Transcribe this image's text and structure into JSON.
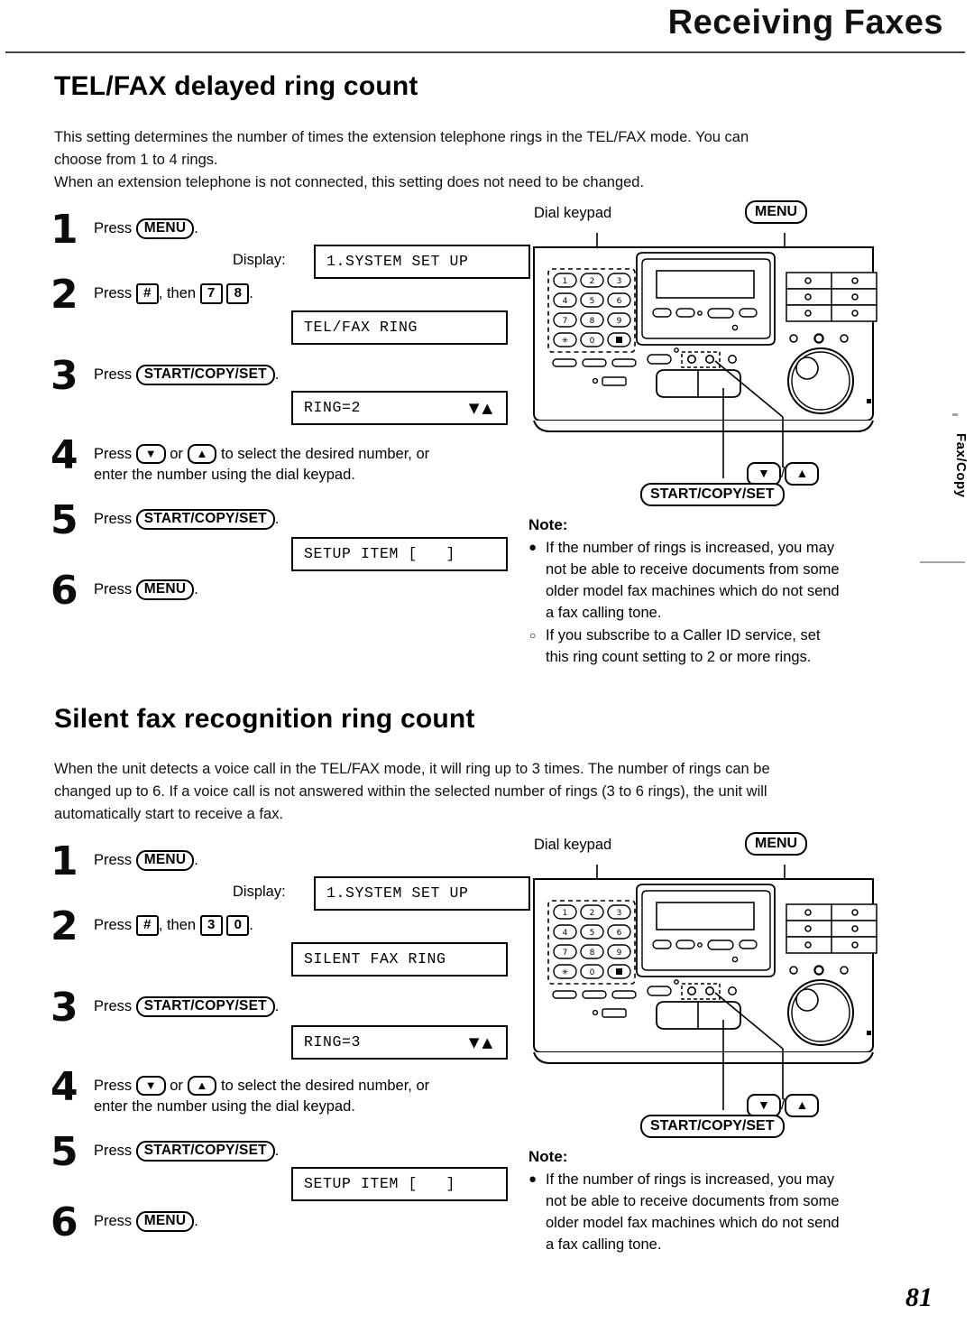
{
  "header": {
    "title": "Receiving Faxes"
  },
  "side_tab": {
    "label": "Fax/Copy"
  },
  "page_number": "81",
  "sections": [
    {
      "title": "TEL/FAX delayed ring count",
      "intro": [
        "This setting determines the number of times the extension telephone rings in the TEL/FAX mode. You can",
        "choose from 1 to 4 rings.",
        "When an extension telephone is not connected, this setting does not need to be changed."
      ],
      "steps": [
        {
          "num": "1",
          "press": "Press",
          "key": "MENU",
          "period": "."
        },
        {
          "num": "2",
          "press": "Press",
          "key1": "#",
          "mid": ", then",
          "key2": "7",
          "key3": "8",
          "period": "."
        },
        {
          "num": "3",
          "press": "Press",
          "key": "START/COPY/SET",
          "period": "."
        },
        {
          "num": "4",
          "press": "Press",
          "key1": "▼",
          "mid": "or",
          "key2": "▲",
          "line1_tail": "to select the desired number, or",
          "line2": "enter the number using the dial keypad."
        },
        {
          "num": "5",
          "press": "Press",
          "key": "START/COPY/SET",
          "period": "."
        },
        {
          "num": "6",
          "press": "Press",
          "key": "MENU",
          "period": "."
        }
      ],
      "display_label": "Display:",
      "lcds": [
        {
          "text": "1.SYSTEM SET UP",
          "arrows": ""
        },
        {
          "text": "TEL/FAX RING",
          "arrows": ""
        },
        {
          "text": "RING=2",
          "arrows": "▼▲"
        },
        {
          "text": "SETUP ITEM [   ]",
          "arrows": ""
        }
      ],
      "diagram": {
        "keypad_label": "Dial keypad",
        "menu_label": "MENU",
        "arrows_label_down": "▼",
        "arrows_label_sep": "/",
        "arrows_label_up": "▲",
        "start_label": "START/COPY/SET",
        "keys": [
          "1",
          "2",
          "3",
          "4",
          "5",
          "6",
          "7",
          "8",
          "9",
          "✳",
          "0",
          "■"
        ]
      },
      "note": {
        "title": "Note:",
        "items": [
          {
            "bullet": "filled",
            "lines": [
              "If the number of rings is increased, you may",
              "not be able to receive documents from some",
              "older model fax machines which do not send",
              "a fax calling tone."
            ]
          },
          {
            "bullet": "hollow",
            "lines": [
              "If you subscribe to a Caller ID service, set",
              "this ring count setting to 2 or more rings."
            ]
          }
        ]
      }
    },
    {
      "title": "Silent fax recognition ring count",
      "intro": [
        "When the unit detects a voice call in the TEL/FAX mode, it will ring up to 3 times. The number of rings can be",
        "changed up to 6. If a voice call is not answered within the selected number of rings (3 to 6 rings), the unit will",
        "automatically start to receive a fax."
      ],
      "steps": [
        {
          "num": "1",
          "press": "Press",
          "key": "MENU",
          "period": "."
        },
        {
          "num": "2",
          "press": "Press",
          "key1": "#",
          "mid": ", then",
          "key2": "3",
          "key3": "0",
          "period": "."
        },
        {
          "num": "3",
          "press": "Press",
          "key": "START/COPY/SET",
          "period": "."
        },
        {
          "num": "4",
          "press": "Press",
          "key1": "▼",
          "mid": "or",
          "key2": "▲",
          "line1_tail": "to select the desired number, or",
          "line2": "enter the number using the dial keypad."
        },
        {
          "num": "5",
          "press": "Press",
          "key": "START/COPY/SET",
          "period": "."
        },
        {
          "num": "6",
          "press": "Press",
          "key": "MENU",
          "period": "."
        }
      ],
      "display_label": "Display:",
      "lcds": [
        {
          "text": "1.SYSTEM SET UP",
          "arrows": ""
        },
        {
          "text": "SILENT FAX RING",
          "arrows": ""
        },
        {
          "text": "RING=3",
          "arrows": "▼▲"
        },
        {
          "text": "SETUP ITEM [   ]",
          "arrows": ""
        }
      ],
      "diagram": {
        "keypad_label": "Dial keypad",
        "menu_label": "MENU",
        "arrows_label_down": "▼",
        "arrows_label_sep": "/",
        "arrows_label_up": "▲",
        "start_label": "START/COPY/SET",
        "keys": [
          "1",
          "2",
          "3",
          "4",
          "5",
          "6",
          "7",
          "8",
          "9",
          "✳",
          "0",
          "■"
        ]
      },
      "note": {
        "title": "Note:",
        "items": [
          {
            "bullet": "filled",
            "lines": [
              "If the number of rings is increased, you may",
              "not be able to receive documents from some",
              "older model fax machines which do not send",
              "a fax calling tone."
            ]
          }
        ]
      }
    }
  ]
}
